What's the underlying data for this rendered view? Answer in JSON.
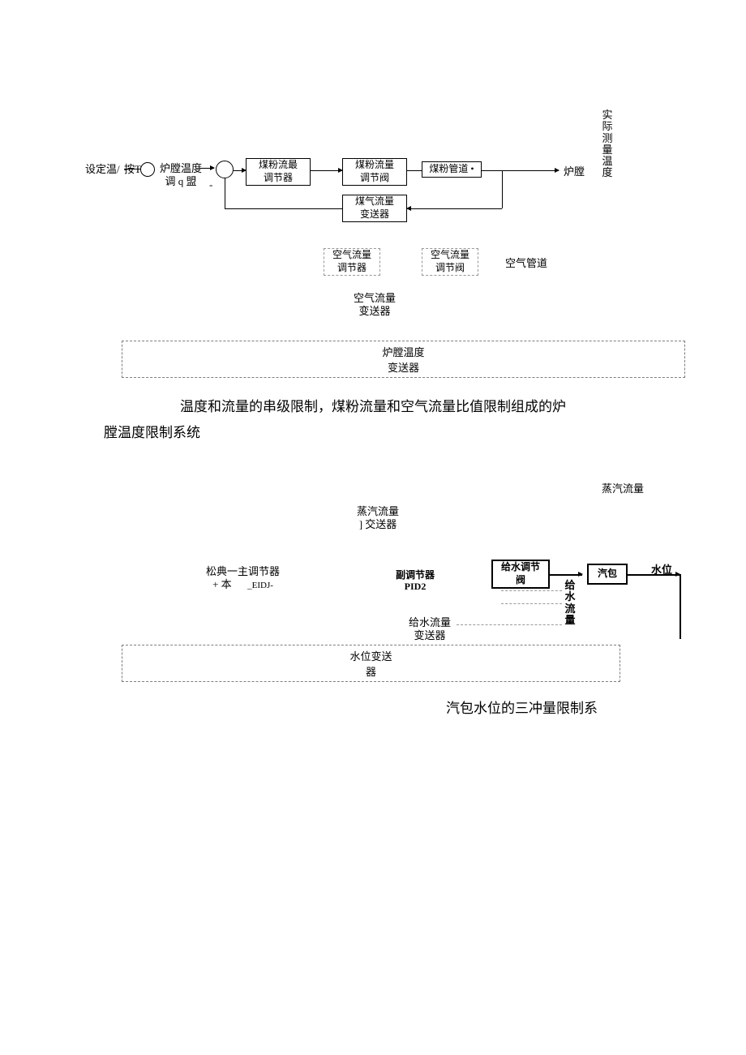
{
  "diagram1": {
    "vert_label": "实际测量温度",
    "set_temp": "设定温/",
    "furnace_temp_ctrl_1": "炉膛温度",
    "furnace_temp_ctrl_2": "调 q 盟",
    "coal_flow_ctrl_1": "煤粉流最",
    "coal_flow_ctrl_2": "调节器",
    "coal_flow_valve_1": "煤粉流量",
    "coal_flow_valve_2": "调节阀",
    "coal_pipe": "煤粉管道 •",
    "furnace": "炉膛",
    "gas_flow_trans_1": "煤气流量",
    "gas_flow_trans_2": "变送器",
    "air_flow_ctrl_1": "空气流量",
    "air_flow_ctrl_2": "调节器",
    "air_flow_valve_1": "空气流量",
    "air_flow_valve_2": "调节阀",
    "air_pipe": "空气管道",
    "air_flow_trans_1": "空气流量",
    "air_flow_trans_2": "变送器",
    "furnace_temp_trans_1": "炉膛温度",
    "furnace_temp_trans_2": "变送器",
    "minus": "-"
  },
  "caption1_a": "温度和流量的串级限制，煤粉流量和空气流量比值限制组成的炉",
  "caption1_b": "膛温度限制系统",
  "diagram2": {
    "steam_flow": "蒸汽流量",
    "steam_flow_trans_1": "蒸汽流量",
    "steam_flow_trans_2": "] 交送器",
    "main_ctrl_1": "松典一主调节器",
    "main_ctrl_2": "+ 本",
    "main_ctrl_3": "_EIDJ-",
    "sub_ctrl_1": "副调节器",
    "sub_ctrl_2": "PID2",
    "water_valve_1": "给水调节",
    "water_valve_2": "阀",
    "drum": "汽包",
    "water_level": "水位",
    "water_flow_vert": "给水流量",
    "water_flow_trans_1": "给水流量",
    "water_flow_trans_2": "变送器",
    "level_trans_1": "水位变送",
    "level_trans_2": "器"
  },
  "caption2": "汽包水位的三冲量限制系"
}
